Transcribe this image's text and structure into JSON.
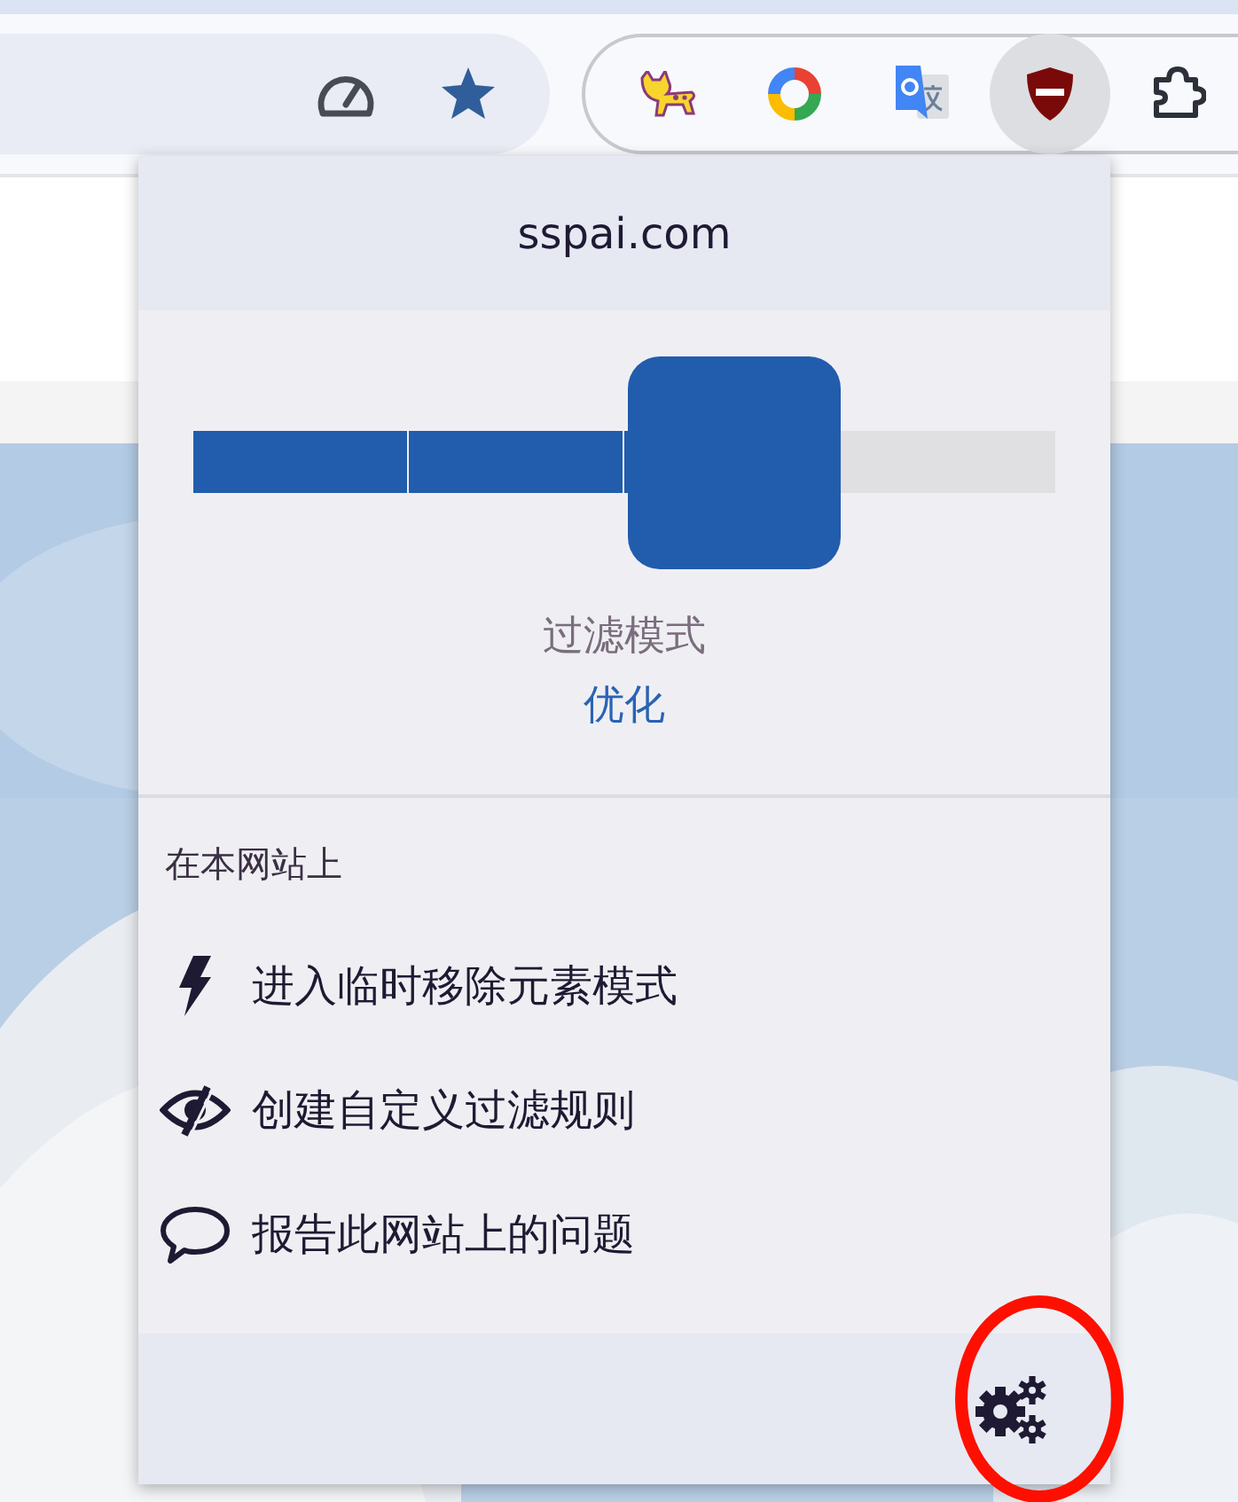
{
  "toolbar": {
    "extension_buttons": [
      {
        "kind": "cat",
        "selected": false
      },
      {
        "kind": "ring",
        "selected": false
      },
      {
        "kind": "translate",
        "selected": false
      },
      {
        "kind": "shield",
        "selected": true
      },
      {
        "kind": "puzzle",
        "selected": false
      }
    ]
  },
  "popup": {
    "site": "sspai.com",
    "filter_mode": {
      "label": "过滤模式",
      "value": "优化",
      "level": 0.75
    },
    "section_title": "在本网站上",
    "actions": [
      {
        "kind": "zap",
        "label": "进入临时移除元素模式"
      },
      {
        "kind": "eye-slash",
        "label": "创建自定义过滤规则"
      },
      {
        "kind": "comment",
        "label": "报告此网站上的问题"
      }
    ]
  }
}
